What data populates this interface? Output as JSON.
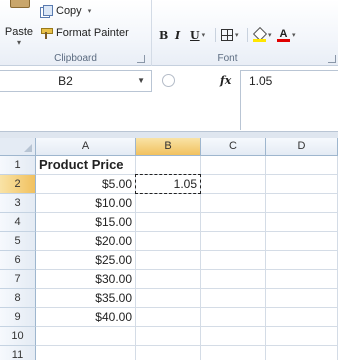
{
  "ribbon": {
    "clipboard": {
      "paste_label": "Paste",
      "copy_label": "Copy",
      "format_painter_label": "Format Painter",
      "group_label": "Clipboard"
    },
    "font": {
      "bold_label": "B",
      "italic_label": "I",
      "underline_label": "U",
      "font_color_letter": "A",
      "group_label": "Font"
    }
  },
  "formula_bar": {
    "name_box": "B2",
    "fx_label": "fx",
    "formula": "1.05"
  },
  "grid": {
    "columns": [
      "A",
      "B",
      "C",
      "D"
    ],
    "rows": [
      "1",
      "2",
      "3",
      "4",
      "5",
      "6",
      "7",
      "8",
      "9",
      "10",
      "11"
    ],
    "active_column": "B",
    "active_row": "2",
    "column_a": [
      "Product Price",
      "$5.00",
      "$10.00",
      "$15.00",
      "$20.00",
      "$25.00",
      "$30.00",
      "$35.00",
      "$40.00",
      "",
      ""
    ],
    "column_b": [
      "",
      "1.05",
      "",
      "",
      "",
      "",
      "",
      "",
      "",
      "",
      ""
    ]
  },
  "colors": {
    "active_header": "#f1c15f",
    "font_color_bar": "#e00000",
    "fill_color_bar": "#ffe600"
  }
}
